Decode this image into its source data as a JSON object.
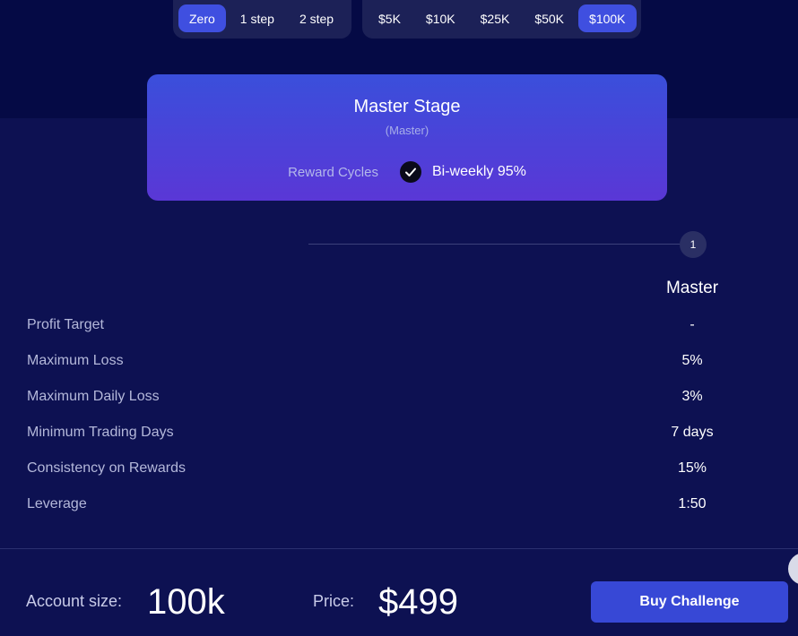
{
  "challenge_types": [
    {
      "label": "Zero",
      "active": true
    },
    {
      "label": "1 step",
      "active": false
    },
    {
      "label": "2 step",
      "active": false
    }
  ],
  "account_sizes": [
    {
      "label": "$5K",
      "active": false
    },
    {
      "label": "$10K",
      "active": false
    },
    {
      "label": "$25K",
      "active": false
    },
    {
      "label": "$50K",
      "active": false
    },
    {
      "label": "$100K",
      "active": true
    }
  ],
  "stage_card": {
    "title": "Master Stage",
    "subtitle": "(Master)",
    "reward_cycles_label": "Reward Cycles",
    "reward_cycles_value": "Bi-weekly 95%"
  },
  "timeline": {
    "step_number": "1"
  },
  "table": {
    "column_header": "Master",
    "rows": [
      {
        "label": "Profit Target",
        "value": "-"
      },
      {
        "label": "Maximum Loss",
        "value": "5%"
      },
      {
        "label": "Maximum Daily Loss",
        "value": "3%"
      },
      {
        "label": "Minimum Trading Days",
        "value": "7 days"
      },
      {
        "label": "Consistency on Rewards",
        "value": "15%"
      },
      {
        "label": "Leverage",
        "value": "1:50"
      }
    ]
  },
  "footer": {
    "account_size_label": "Account size:",
    "account_size_value": "100k",
    "price_label": "Price:",
    "price_value": "$499",
    "buy_label": "Buy Challenge"
  },
  "colors": {
    "accent": "#3f4fe0",
    "background": "#0d1152",
    "card_top": "#3a4fdb",
    "card_bottom": "#5a37d6"
  },
  "icons": {
    "reward_check": "check-circle-icon"
  }
}
